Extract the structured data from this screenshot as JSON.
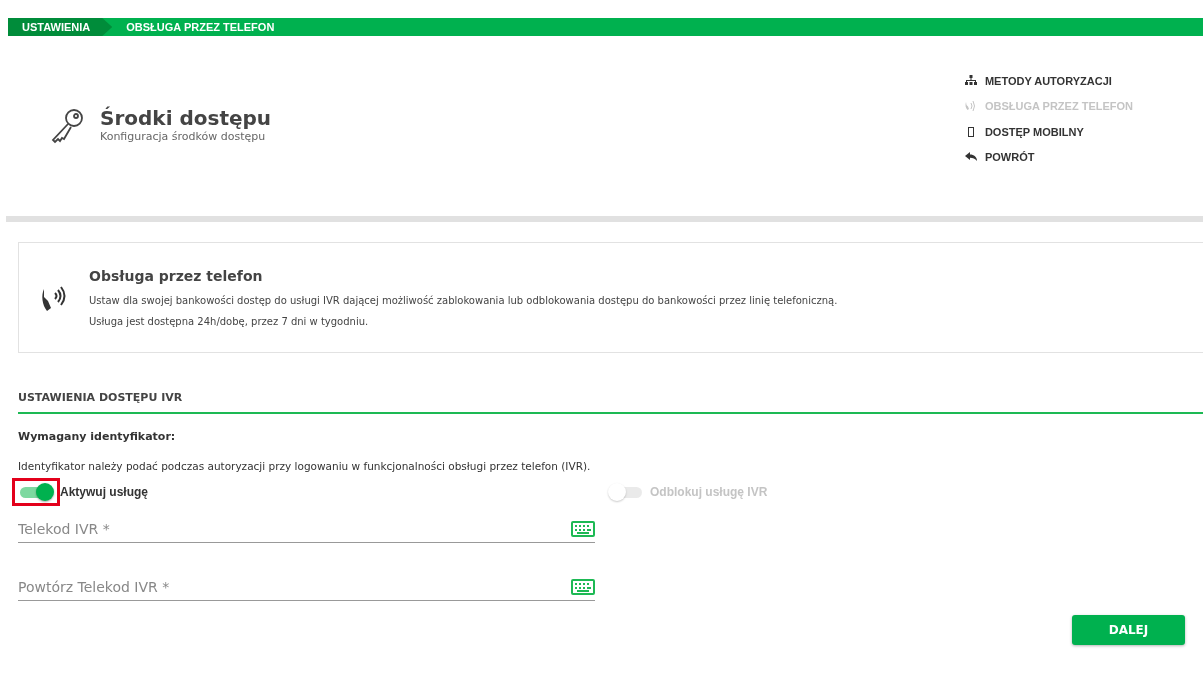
{
  "breadcrumbs": [
    {
      "label": "USTAWIENIA",
      "selected": false
    },
    {
      "label": "OBSŁUGA PRZEZ TELEFON",
      "selected": true
    }
  ],
  "header": {
    "title": "Środki dostępu",
    "subtitle": "Konfiguracja środków dostępu"
  },
  "side_nav": [
    {
      "label": "METODY AUTORYZACJI",
      "disabled": false
    },
    {
      "label": "OBSŁUGA PRZEZ TELEFON",
      "disabled": true
    },
    {
      "label": "DOSTĘP MOBILNY",
      "disabled": false
    },
    {
      "label": "POWRÓT",
      "disabled": false
    }
  ],
  "info_card": {
    "title": "Obsługa przez telefon",
    "lines": [
      "Ustaw dla swojej bankowości dostęp do usługi IVR dającej możliwość zablokowania lub odblokowania dostępu do bankowości przez linię telefoniczną.",
      "Usługa jest dostępna 24h/dobę, przez 7 dni w tygodniu."
    ]
  },
  "section": {
    "title": "USTAWIENIA DOSTĘPU IVR",
    "subtitle": "Wymagany identyfikator:",
    "description": "Identyfikator należy podać podczas autoryzacji przy logowaniu w funkcjonalności obsługi przez telefon (IVR)."
  },
  "toggles": [
    {
      "label": "Aktywuj usługę",
      "on": true,
      "disabled": false,
      "highlighted": true
    },
    {
      "label": "Odblokuj usługę IVR",
      "on": false,
      "disabled": true,
      "highlighted": false
    }
  ],
  "fields": [
    {
      "placeholder": "Telekod IVR *"
    },
    {
      "placeholder": "Powtórz Telekod IVR *"
    }
  ],
  "buttons": [
    "DALEJ"
  ]
}
